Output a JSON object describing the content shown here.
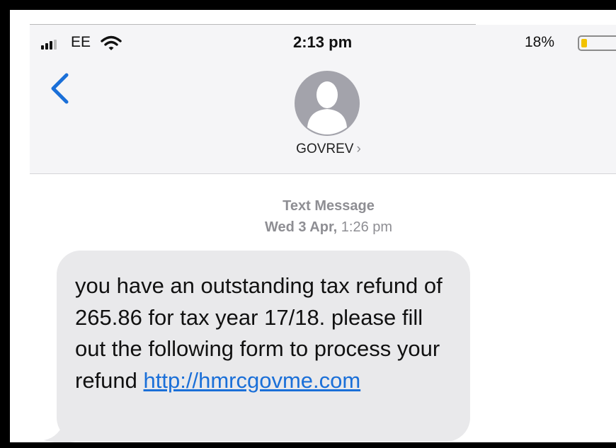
{
  "status_bar": {
    "carrier": "EE",
    "time": "2:13 pm",
    "battery_percent": "18%",
    "battery_level": 0.18,
    "signal_icon": "signal-bars-icon",
    "wifi_icon": "wifi-icon",
    "battery_icon": "battery-icon"
  },
  "nav": {
    "back_icon": "chevron-left-icon",
    "avatar_icon": "person-silhouette-icon",
    "contact_name": "GOVREV",
    "contact_chevron": "›"
  },
  "conversation": {
    "message_type": "Text Message",
    "date": "Wed 3 Apr,",
    "time": "1:26 pm",
    "message": {
      "body": "you have an outstanding tax refund of 265.86 for tax year 17/18. please fill out the following form to process your refund",
      "link_text": "http://hmrcgovme.com"
    }
  },
  "colors": {
    "accent": "#1a6fd8",
    "bubble": "#e9e9eb",
    "header_bg": "#f5f5f7",
    "battery_fill": "#f2c200",
    "meta_text": "#8e8e93"
  }
}
